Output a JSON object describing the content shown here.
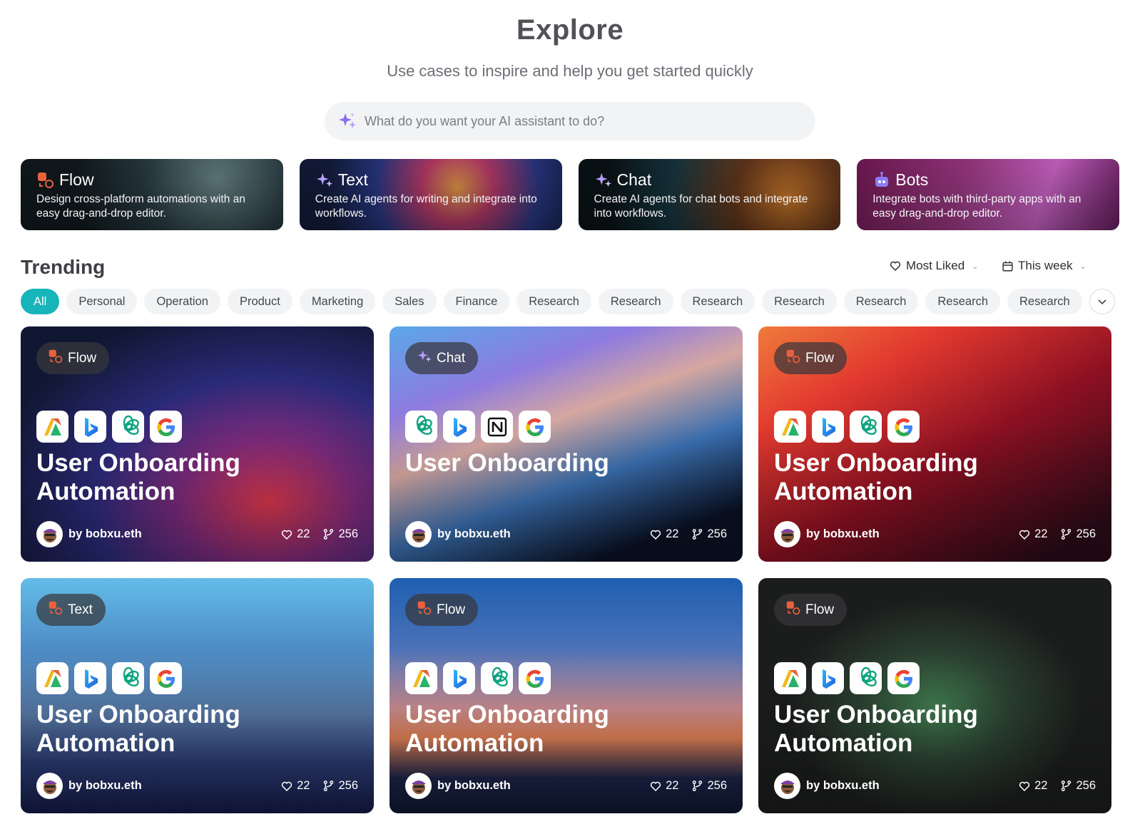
{
  "header": {
    "title": "Explore",
    "subtitle": "Use cases to inspire and help you get started quickly"
  },
  "search": {
    "placeholder": "What do you want your AI assistant to do?",
    "value": ""
  },
  "categories": [
    {
      "title": "Flow",
      "description": "Design cross-platform automations with an easy drag-and-drop editor.",
      "icon": "flow-icon"
    },
    {
      "title": "Text",
      "description": "Create AI agents for writing and integrate into workflows.",
      "icon": "sparkle-icon"
    },
    {
      "title": "Chat",
      "description": "Create AI agents for chat bots and integrate into workflows.",
      "icon": "sparkle-icon"
    },
    {
      "title": "Bots",
      "description": "Integrate bots with third-party apps with an easy drag-and-drop editor.",
      "icon": "robot-icon"
    }
  ],
  "trending": {
    "title": "Trending",
    "sort_label": "Most Liked",
    "period_label": "This week"
  },
  "filters": [
    "All",
    "Personal",
    "Operation",
    "Product",
    "Marketing",
    "Sales",
    "Finance",
    "Research",
    "Research",
    "Research",
    "Research",
    "Research",
    "Research",
    "Research"
  ],
  "active_filter": "All",
  "cards": [
    {
      "tag": "Flow",
      "title": "User Onboarding Automation",
      "author": "by bobxu.eth",
      "likes": "22",
      "forks": "256",
      "apps": [
        "automate-icon",
        "bing-icon",
        "openai-icon",
        "google-icon"
      ]
    },
    {
      "tag": "Chat",
      "title": "User Onboarding",
      "author": "by bobxu.eth",
      "likes": "22",
      "forks": "256",
      "apps": [
        "openai-icon",
        "bing-icon",
        "notion-icon",
        "google-icon"
      ]
    },
    {
      "tag": "Flow",
      "title": "User Onboarding Automation",
      "author": "by bobxu.eth",
      "likes": "22",
      "forks": "256",
      "apps": [
        "automate-icon",
        "bing-icon",
        "openai-icon",
        "google-icon"
      ]
    },
    {
      "tag": "Text",
      "title": "User Onboarding Automation",
      "author": "by bobxu.eth",
      "likes": "22",
      "forks": "256",
      "apps": [
        "automate-icon",
        "bing-icon",
        "openai-icon",
        "google-icon"
      ]
    },
    {
      "tag": "Flow",
      "title": "User Onboarding Automation",
      "author": "by bobxu.eth",
      "likes": "22",
      "forks": "256",
      "apps": [
        "automate-icon",
        "bing-icon",
        "openai-icon",
        "google-icon"
      ]
    },
    {
      "tag": "Flow",
      "title": "User Onboarding Automation",
      "author": "by bobxu.eth",
      "likes": "22",
      "forks": "256",
      "apps": [
        "automate-icon",
        "bing-icon",
        "openai-icon",
        "google-icon"
      ]
    }
  ],
  "colors": {
    "accent": "#17b5b9",
    "chip_bg": "#f2f3f5",
    "flow_icon": "#e8613c",
    "sparkle_icon": "#a78bfa",
    "bots_icon": "#8b7cf6"
  }
}
